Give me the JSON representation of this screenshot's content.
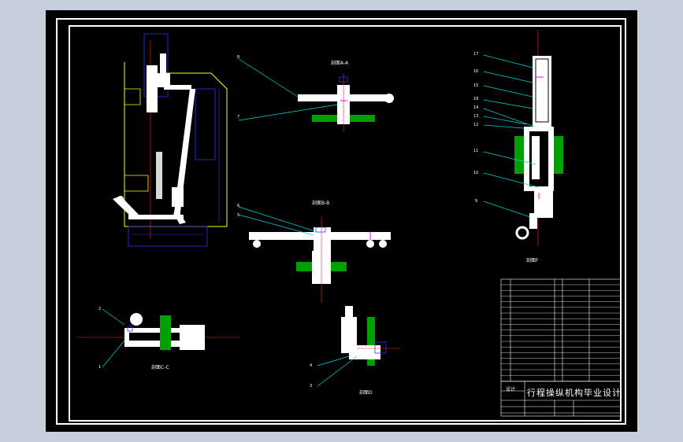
{
  "drawing": {
    "title_block": {
      "title": "行程操纵机构毕业设计",
      "role_label": "设计"
    },
    "section_labels": [
      {
        "id": "a-a",
        "text": "剖面A-A"
      },
      {
        "id": "b-b",
        "text": "剖面B-B"
      },
      {
        "id": "f",
        "text": "剖面F"
      },
      {
        "id": "c-c",
        "text": "剖面C-C"
      },
      {
        "id": "d",
        "text": "剖面D"
      }
    ],
    "part_numbers": [
      "1",
      "2",
      "3",
      "4",
      "5",
      "6",
      "7",
      "8",
      "9",
      "10",
      "11",
      "12",
      "13",
      "14",
      "15",
      "16",
      "17",
      "18"
    ],
    "colors": {
      "frame": "#ffffff",
      "part": "#ffffff",
      "outline_yellow": "#ffff00",
      "dimension_blue": "#3333ff",
      "centerline_red": "#ff2222",
      "leader_cyan": "#00d8d8",
      "hatch_green": "#00a000",
      "accent_magenta": "#ff00ff"
    }
  }
}
